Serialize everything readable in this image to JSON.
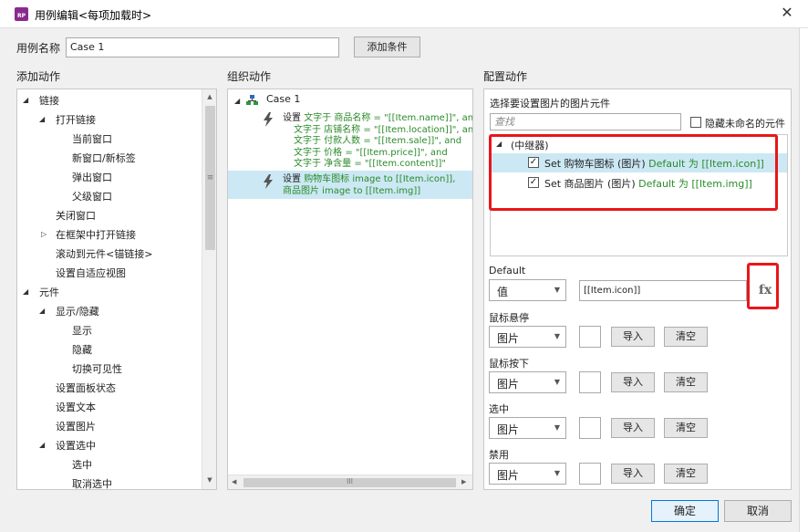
{
  "window": {
    "title": "用例编辑<每项加载时>",
    "icon_text": "RP",
    "close_glyph": "✕"
  },
  "case_name": {
    "label": "用例名称",
    "value": "Case 1",
    "add_condition": "添加条件"
  },
  "add_action": {
    "header": "添加动作",
    "items": [
      {
        "text": "链接",
        "tri": "◢"
      },
      {
        "text": "打开链接",
        "tri": "◢"
      },
      {
        "text": "当前窗口"
      },
      {
        "text": "新窗口/新标签"
      },
      {
        "text": "弹出窗口"
      },
      {
        "text": "父级窗口"
      },
      {
        "text": "关闭窗口"
      },
      {
        "text": "在框架中打开链接",
        "tri": "▷"
      },
      {
        "text": "滚动到元件<锚链接>"
      },
      {
        "text": "设置自适应视图"
      },
      {
        "text": "元件",
        "tri": "◢"
      },
      {
        "text": "显示/隐藏",
        "tri": "◢"
      },
      {
        "text": "显示"
      },
      {
        "text": "隐藏"
      },
      {
        "text": "切换可见性"
      },
      {
        "text": "设置面板状态"
      },
      {
        "text": "设置文本"
      },
      {
        "text": "设置图片"
      },
      {
        "text": "设置选中",
        "tri": "◢"
      },
      {
        "text": "选中"
      },
      {
        "text": "取消选中"
      }
    ],
    "scroll_up": "▲",
    "scroll_down": "▼",
    "grip": "≡"
  },
  "organize": {
    "header": "组织动作",
    "case_label": "Case 1",
    "tri": "◢",
    "action1": {
      "lines": [
        {
          "pre": "设置 ",
          "green": "文字于 商品名称 = \"[[Item.name]]\", and"
        },
        {
          "pre": "",
          "green": "文字于 店铺名称 = \"[[Item.location]]\", and"
        },
        {
          "pre": "",
          "green": "文字于 付款人数 = \"[[Item.sale]]\", and"
        },
        {
          "pre": "",
          "green": "文字于 价格 = \"[[Item.price]]\", and"
        },
        {
          "pre": "",
          "green": "文字于 净含量 = \"[[Item.content]]\""
        }
      ]
    },
    "action2": {
      "lines": [
        {
          "pre": "设置 ",
          "green": "购物车图标 image to [[Item.icon]],"
        },
        {
          "pre": "",
          "green": "商品图片 image to [[Item.img]]"
        }
      ]
    },
    "hscroll_left": "◀",
    "hscroll_right": "▶",
    "grip": "III"
  },
  "configure": {
    "header": "配置动作",
    "select_title": "选择要设置图片的图片元件",
    "search_placeholder": "查找",
    "hide_unnamed": "隐藏未命名的元件",
    "tree_root": "(中继器)",
    "tree_root_tri": "◢",
    "items": [
      {
        "checked": "✓",
        "black": "Set 购物车图标 (图片) ",
        "green": "Default 为 [[Item.icon]]"
      },
      {
        "checked": "✓",
        "black": "Set 商品图片 (图片) ",
        "green": "Default 为 [[Item.img]]"
      }
    ],
    "default": {
      "label": "Default",
      "type": "值",
      "value": "[[Item.icon]]",
      "fx": "fx"
    },
    "states": [
      {
        "label": "鼠标悬停",
        "type": "图片",
        "import": "导入",
        "clear": "清空"
      },
      {
        "label": "鼠标按下",
        "type": "图片",
        "import": "导入",
        "clear": "清空"
      },
      {
        "label": "选中",
        "type": "图片",
        "import": "导入",
        "clear": "清空"
      },
      {
        "label": "禁用",
        "type": "图片",
        "import": "导入",
        "clear": "清空"
      }
    ],
    "dropdown_glyph": "▼",
    "scroll_up": "▲",
    "scroll_down": "▼"
  },
  "footer": {
    "ok": "确定",
    "cancel": "取消"
  },
  "colors": {
    "highlight_red": "#e8161b",
    "selected_row": "#cce8f4",
    "green_text": "#2a8a2a"
  }
}
